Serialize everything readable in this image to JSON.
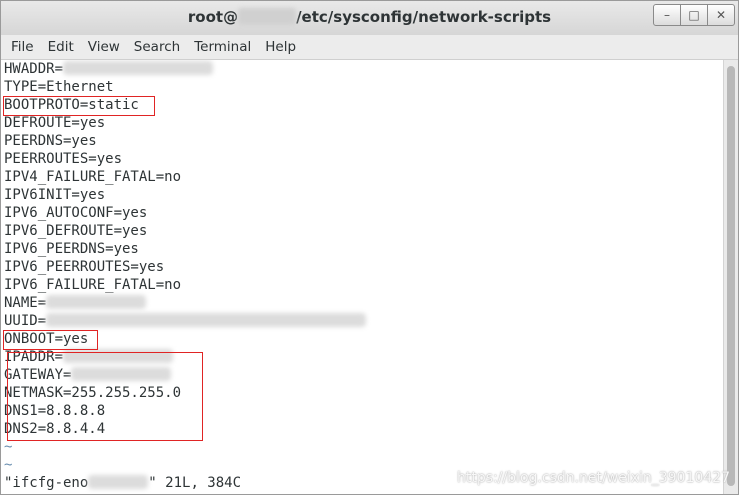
{
  "window": {
    "title_prefix": "root@",
    "title_suffix": "/etc/sysconfig/network-scripts",
    "controls": [
      "–",
      "□",
      "✕"
    ]
  },
  "menu": [
    "File",
    "Edit",
    "View",
    "Search",
    "Terminal",
    "Help"
  ],
  "lines": [
    "HWADDR=",
    "TYPE=Ethernet",
    "BOOTPROTO=static",
    "DEFROUTE=yes",
    "PEERDNS=yes",
    "PEERROUTES=yes",
    "IPV4_FAILURE_FATAL=no",
    "IPV6INIT=yes",
    "IPV6_AUTOCONF=yes",
    "IPV6_DEFROUTE=yes",
    "IPV6_PEERDNS=yes",
    "IPV6_PEERROUTES=yes",
    "IPV6_FAILURE_FATAL=no",
    "NAME=",
    "UUID=",
    "ONBOOT=yes",
    "IPADDR=",
    "GATEWAY=",
    "NETMASK=255.255.255.0",
    "DNS1=8.8.8.8",
    "DNS2=8.8.4.4",
    "~",
    "~"
  ],
  "status": {
    "prefix": "\"ifcfg-eno",
    "suffix": "\" 21L, 384C"
  },
  "watermark": "https://blog.csdn.net/weixin_39010427",
  "colors": {
    "highlight": "#e02424",
    "tilde": "#6a8fb0"
  }
}
